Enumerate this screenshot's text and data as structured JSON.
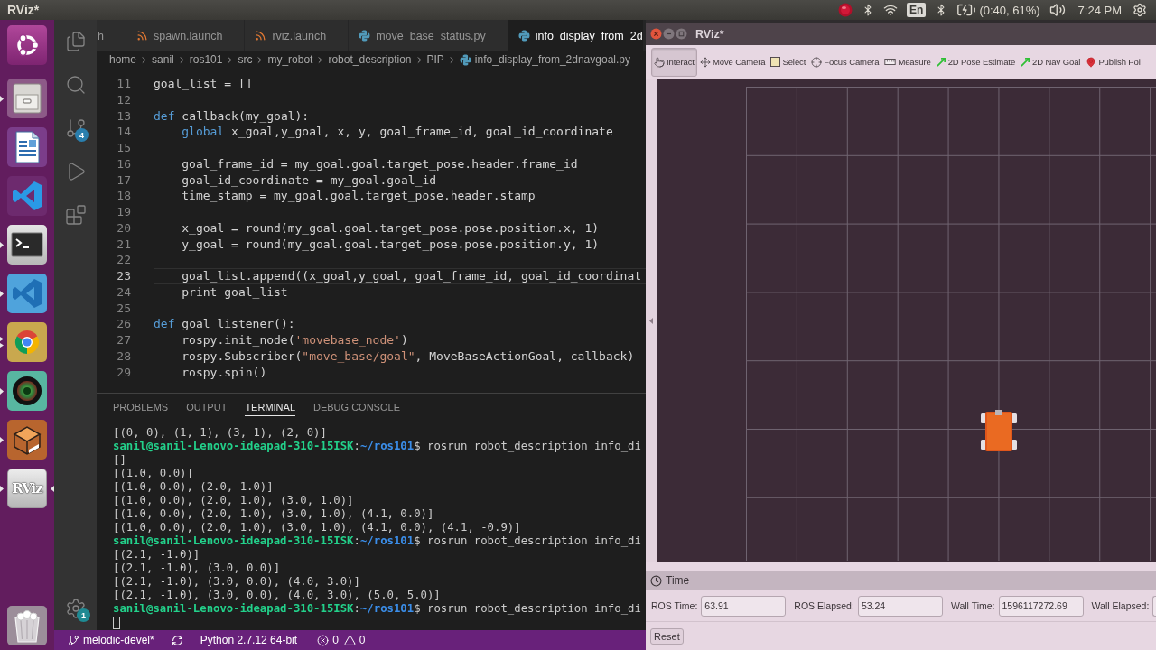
{
  "top_bar": {
    "title": "RViz*",
    "keyboard_layout": "En",
    "battery": "(0:40, 61%)",
    "clock": "7:24 PM"
  },
  "launcher": {
    "items": [
      {
        "kind": "home",
        "running": false,
        "multiple_windows": false,
        "focused": false
      },
      {
        "kind": "files",
        "running": true,
        "multiple_windows": false,
        "focused": false
      },
      {
        "kind": "writer",
        "running": false,
        "multiple_windows": false,
        "focused": false
      },
      {
        "kind": "code",
        "running": false,
        "multiple_windows": false,
        "focused": false
      },
      {
        "kind": "terminal",
        "running": true,
        "multiple_windows": false,
        "focused": false
      },
      {
        "kind": "code-alt",
        "running": true,
        "multiple_windows": false,
        "focused": false
      },
      {
        "kind": "browser",
        "running": true,
        "multiple_windows": true,
        "focused": false
      },
      {
        "kind": "camera",
        "running": true,
        "multiple_windows": false,
        "focused": false
      },
      {
        "kind": "box",
        "running": true,
        "multiple_windows": false,
        "focused": false
      },
      {
        "kind": "rviz",
        "label": "RViz",
        "running": true,
        "multiple_windows": false,
        "focused": true
      },
      {
        "kind": "trash",
        "running": false,
        "multiple_windows": false,
        "focused": false
      }
    ]
  },
  "vscode": {
    "activity_bar": [
      {
        "kind": "explorer",
        "selected": false
      },
      {
        "kind": "search",
        "selected": false
      },
      {
        "kind": "source-control",
        "badge": "4",
        "selected": false
      },
      {
        "kind": "run",
        "selected": false
      },
      {
        "kind": "extensions",
        "selected": false
      }
    ],
    "settings_badge": "1",
    "tabs": [
      {
        "label": "h",
        "selected": false
      },
      {
        "label": "spawn.launch",
        "kind": "launch",
        "selected": false
      },
      {
        "label": "rviz.launch",
        "kind": "launch",
        "selected": false
      },
      {
        "label": "move_base_status.py",
        "kind": "python",
        "selected": false
      },
      {
        "label": "info_display_from_2d",
        "kind": "python",
        "selected": true
      }
    ],
    "breadcrumb": [
      {
        "label": "home"
      },
      {
        "label": "sanil"
      },
      {
        "label": "ros101"
      },
      {
        "label": "src"
      },
      {
        "label": "my_robot"
      },
      {
        "label": "robot_description"
      },
      {
        "label": "PIP"
      },
      {
        "label": "info_display_from_2dnavgoal.py",
        "kind": "python"
      }
    ],
    "code_lines": [
      {
        "number": "11",
        "current": false,
        "tokens": [
          {
            "kind": "plain",
            "text": "goal_list = []"
          }
        ]
      },
      {
        "number": "12",
        "current": false
      },
      {
        "number": "13",
        "current": false,
        "tokens": [
          {
            "kind": "keyword",
            "text": "def"
          },
          {
            "kind": "plain",
            "text": " callback(my_goal):"
          }
        ],
        "children": [
          {
            "number": "14",
            "current": false,
            "tokens": [
              {
                "kind": "keyword",
                "text": "global"
              },
              {
                "kind": "plain",
                "text": " x_goal,y_goal, x, y, goal_frame_id, goal_id_coordinate"
              }
            ]
          },
          {
            "number": "15",
            "current": false
          },
          {
            "number": "16",
            "current": false,
            "tokens": [
              {
                "kind": "plain",
                "text": "goal_frame_id = my_goal.goal.target_pose.header.frame_id"
              }
            ]
          },
          {
            "number": "17",
            "current": false,
            "tokens": [
              {
                "kind": "plain",
                "text": "goal_id_coordinate = my_goal.goal_id"
              }
            ]
          },
          {
            "number": "18",
            "current": false,
            "tokens": [
              {
                "kind": "plain",
                "text": "time_stamp = my_goal.goal.target_pose.header.stamp"
              }
            ]
          },
          {
            "number": "19",
            "current": false
          },
          {
            "number": "20",
            "current": false,
            "tokens": [
              {
                "kind": "plain",
                "text": "x_goal = round(my_goal.goal.target_pose.pose.position.x, 1)"
              }
            ]
          },
          {
            "number": "21",
            "current": false,
            "tokens": [
              {
                "kind": "plain",
                "text": "y_goal = round(my_goal.goal.target_pose.pose.position.y, 1)"
              }
            ]
          },
          {
            "number": "22",
            "current": false
          },
          {
            "number": "23",
            "current": true,
            "tokens": [
              {
                "kind": "plain",
                "text": "goal_list.append((x_goal,y_goal, goal_frame_id, goal_id_coordinat"
              }
            ]
          },
          {
            "number": "24",
            "current": false,
            "tokens": [
              {
                "kind": "plain",
                "text": "print goal_list"
              }
            ]
          }
        ]
      },
      {
        "number": "25",
        "current": false
      },
      {
        "number": "26",
        "current": false,
        "tokens": [
          {
            "kind": "keyword",
            "text": "def"
          },
          {
            "kind": "plain",
            "text": " goal_listener():"
          }
        ],
        "children": [
          {
            "number": "27",
            "current": false,
            "tokens": [
              {
                "kind": "plain",
                "text": "rospy.init_node("
              },
              {
                "kind": "string",
                "text": "'movebase_node'"
              },
              {
                "kind": "plain",
                "text": ")"
              }
            ]
          },
          {
            "number": "28",
            "current": false,
            "tokens": [
              {
                "kind": "plain",
                "text": "rospy.Subscriber("
              },
              {
                "kind": "string",
                "text": "\"move_base/goal\""
              },
              {
                "kind": "plain",
                "text": ", MoveBaseActionGoal, callback)"
              }
            ]
          },
          {
            "number": "29",
            "current": false,
            "tokens": [
              {
                "kind": "plain",
                "text": "rospy.spin()"
              }
            ]
          }
        ]
      }
    ],
    "panel_tabs": [
      {
        "label": "PROBLEMS",
        "selected": false
      },
      {
        "label": "OUTPUT",
        "selected": false
      },
      {
        "label": "TERMINAL",
        "selected": true
      },
      {
        "label": "DEBUG CONSOLE",
        "selected": false
      }
    ],
    "terminal_lines": [
      {
        "kind": "output",
        "text": "[(0, 0), (1, 1), (3, 1), (2, 0)]"
      },
      {
        "kind": "prompt",
        "user_host": "sanil@sanil-Lenovo-ideapad-310-15ISK",
        "separator": ":",
        "path": "~/ros101",
        "command": "$ rosrun robot_description info_di"
      },
      {
        "kind": "output",
        "text": "[]"
      },
      {
        "kind": "output",
        "text": "[(1.0, 0.0)]"
      },
      {
        "kind": "output",
        "text": "[(1.0, 0.0), (2.0, 1.0)]"
      },
      {
        "kind": "output",
        "text": "[(1.0, 0.0), (2.0, 1.0), (3.0, 1.0)]"
      },
      {
        "kind": "output",
        "text": "[(1.0, 0.0), (2.0, 1.0), (3.0, 1.0), (4.1, 0.0)]"
      },
      {
        "kind": "output",
        "text": "[(1.0, 0.0), (2.0, 1.0), (3.0, 1.0), (4.1, 0.0), (4.1, -0.9)]"
      },
      {
        "kind": "prompt",
        "user_host": "sanil@sanil-Lenovo-ideapad-310-15ISK",
        "separator": ":",
        "path": "~/ros101",
        "command": "$ rosrun robot_description info_di"
      },
      {
        "kind": "output",
        "text": "[(2.1, -1.0)]"
      },
      {
        "kind": "output",
        "text": "[(2.1, -1.0), (3.0, 0.0)]"
      },
      {
        "kind": "output",
        "text": "[(2.1, -1.0), (3.0, 0.0), (4.0, 3.0)]"
      },
      {
        "kind": "output",
        "text": "[(2.1, -1.0), (3.0, 0.0), (4.0, 3.0), (5.0, 5.0)]"
      },
      {
        "kind": "prompt",
        "user_host": "sanil@sanil-Lenovo-ideapad-310-15ISK",
        "separator": ":",
        "path": "~/ros101",
        "command": "$ rosrun robot_description info_di"
      },
      {
        "kind": "cursor"
      }
    ]
  },
  "status_bar": {
    "branch": "melodic-devel*",
    "interpreter": "Python 2.7.12 64-bit",
    "errors": "0",
    "warnings": "0"
  },
  "rviz": {
    "title": "RViz*",
    "tools": [
      {
        "label": "Interact",
        "kind": "interact",
        "selected": true
      },
      {
        "label": "Move Camera",
        "kind": "move-camera",
        "selected": false
      },
      {
        "label": "Select",
        "kind": "select",
        "selected": false
      },
      {
        "label": "Focus Camera",
        "kind": "focus",
        "selected": false
      },
      {
        "label": "Measure",
        "kind": "measure",
        "selected": false
      },
      {
        "label": "2D Pose Estimate",
        "kind": "pose-arrow",
        "selected": false
      },
      {
        "label": "2D Nav Goal",
        "kind": "nav-arrow",
        "selected": false
      },
      {
        "label": "Publish Poi",
        "kind": "pin",
        "selected": false
      }
    ],
    "time_panel": {
      "title": "Time",
      "fields": [
        {
          "label": "ROS Time:",
          "value": "63.91"
        },
        {
          "label": "ROS Elapsed:",
          "value": "53.24"
        },
        {
          "label": "Wall Time:",
          "value": "1596117272.69"
        },
        {
          "label": "Wall Elapsed:"
        }
      ],
      "reset_button": "Reset"
    }
  }
}
